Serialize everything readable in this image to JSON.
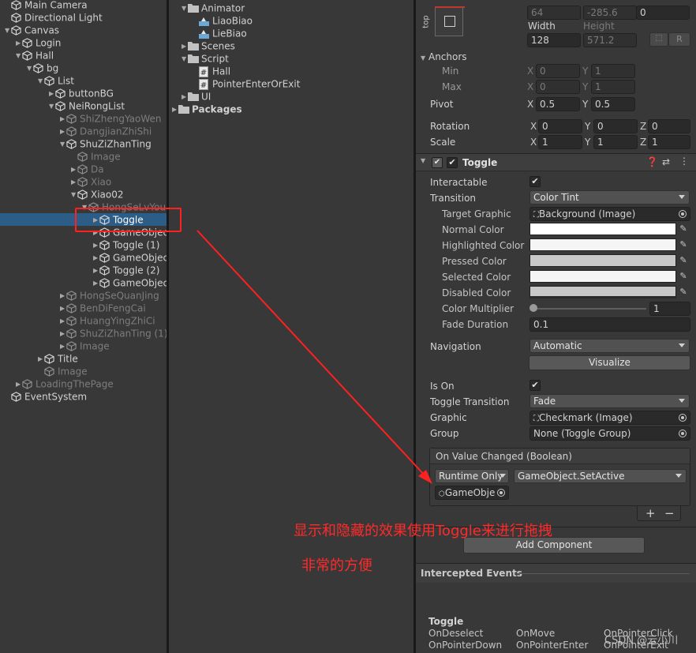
{
  "hierarchy": {
    "items": [
      {
        "label": "Main Camera",
        "indent": 0,
        "expanded": null,
        "dim": false,
        "selected": false
      },
      {
        "label": "Directional Light",
        "indent": 0,
        "expanded": null,
        "dim": false,
        "selected": false
      },
      {
        "label": "Canvas",
        "indent": 0,
        "expanded": true,
        "dim": false,
        "selected": false
      },
      {
        "label": "Login",
        "indent": 1,
        "expanded": false,
        "dim": false,
        "selected": false
      },
      {
        "label": "Hall",
        "indent": 1,
        "expanded": true,
        "dim": false,
        "selected": false
      },
      {
        "label": "bg",
        "indent": 2,
        "expanded": true,
        "dim": false,
        "selected": false
      },
      {
        "label": "List",
        "indent": 3,
        "expanded": true,
        "dim": false,
        "selected": false
      },
      {
        "label": "buttonBG",
        "indent": 4,
        "expanded": false,
        "dim": false,
        "selected": false
      },
      {
        "label": "NeiRongList",
        "indent": 4,
        "expanded": true,
        "dim": false,
        "selected": false
      },
      {
        "label": "ShiZhengYaoWen",
        "indent": 5,
        "expanded": false,
        "dim": true,
        "selected": false
      },
      {
        "label": "DangjianZhiShi",
        "indent": 5,
        "expanded": false,
        "dim": true,
        "selected": false
      },
      {
        "label": "ShuZiZhanTing",
        "indent": 5,
        "expanded": true,
        "dim": false,
        "selected": false
      },
      {
        "label": "Image",
        "indent": 6,
        "expanded": null,
        "dim": true,
        "selected": false
      },
      {
        "label": "Da",
        "indent": 6,
        "expanded": false,
        "dim": true,
        "selected": false
      },
      {
        "label": "Xiao",
        "indent": 6,
        "expanded": false,
        "dim": true,
        "selected": false
      },
      {
        "label": "Xiao02",
        "indent": 6,
        "expanded": true,
        "dim": false,
        "selected": false
      },
      {
        "label": "HongSeLvYou",
        "indent": 7,
        "expanded": true,
        "dim": true,
        "selected": false
      },
      {
        "label": "Toggle",
        "indent": 8,
        "expanded": false,
        "dim": false,
        "selected": true
      },
      {
        "label": "GameObject",
        "indent": 8,
        "expanded": false,
        "dim": false,
        "selected": false
      },
      {
        "label": "Toggle (1)",
        "indent": 8,
        "expanded": false,
        "dim": false,
        "selected": false
      },
      {
        "label": "GameObject (",
        "indent": 8,
        "expanded": false,
        "dim": false,
        "selected": false
      },
      {
        "label": "Toggle (2)",
        "indent": 8,
        "expanded": false,
        "dim": false,
        "selected": false
      },
      {
        "label": "GameObject (",
        "indent": 8,
        "expanded": false,
        "dim": false,
        "selected": false
      },
      {
        "label": "HongSeQuanJing",
        "indent": 5,
        "expanded": false,
        "dim": true,
        "selected": false
      },
      {
        "label": "BenDiFengCai",
        "indent": 5,
        "expanded": false,
        "dim": true,
        "selected": false
      },
      {
        "label": "HuangYingZhiCi",
        "indent": 5,
        "expanded": false,
        "dim": true,
        "selected": false
      },
      {
        "label": "ShuZiZhanTing (1)",
        "indent": 5,
        "expanded": false,
        "dim": true,
        "selected": false
      },
      {
        "label": "Image",
        "indent": 5,
        "expanded": false,
        "dim": true,
        "selected": false
      },
      {
        "label": "Title",
        "indent": 3,
        "expanded": false,
        "dim": false,
        "selected": false
      },
      {
        "label": "Image",
        "indent": 3,
        "expanded": null,
        "dim": true,
        "selected": false
      },
      {
        "label": "LoadingThePage",
        "indent": 1,
        "expanded": false,
        "dim": true,
        "selected": false
      },
      {
        "label": "EventSystem",
        "indent": 0,
        "expanded": null,
        "dim": false,
        "selected": false
      }
    ]
  },
  "project": {
    "items": [
      {
        "label": "Animator",
        "type": "folder",
        "indent": 0,
        "expanded": true
      },
      {
        "label": "LiaoBiao",
        "type": "anim",
        "indent": 1,
        "expanded": null
      },
      {
        "label": "LieBiao",
        "type": "anim",
        "indent": 1,
        "expanded": null
      },
      {
        "label": "Scenes",
        "type": "folder",
        "indent": 0,
        "expanded": false
      },
      {
        "label": "Script",
        "type": "folder",
        "indent": 0,
        "expanded": true
      },
      {
        "label": "Hall",
        "type": "script",
        "indent": 1,
        "expanded": null
      },
      {
        "label": "PointerEnterOrExit",
        "type": "script",
        "indent": 1,
        "expanded": null
      },
      {
        "label": "UI",
        "type": "folder",
        "indent": 0,
        "expanded": false
      },
      {
        "label": "Packages",
        "type": "folder",
        "indent": -1,
        "expanded": false
      }
    ]
  },
  "rect_transform": {
    "pos_x": "64",
    "pos_y": "-285.6",
    "pos_z": "0",
    "width_label": "Width",
    "height_label": "Height",
    "width": "128",
    "height": "571.2",
    "anchor_side_label": "top",
    "anchors_label": "Anchors",
    "min_label": "Min",
    "max_label": "Max",
    "min_x": "0",
    "min_y": "1",
    "max_x": "0",
    "max_y": "1",
    "pivot_label": "Pivot",
    "pivot_x": "0.5",
    "pivot_y": "0.5",
    "rotation_label": "Rotation",
    "rot_x": "0",
    "rot_y": "0",
    "rot_z": "0",
    "scale_label": "Scale",
    "scale_x": "1",
    "scale_y": "1",
    "scale_z": "1",
    "r_button": "R",
    "axis_x": "X",
    "axis_y": "Y",
    "axis_z": "Z"
  },
  "toggle": {
    "title": "Toggle",
    "interactable_label": "Interactable",
    "transition_label": "Transition",
    "transition_value": "Color Tint",
    "target_graphic_label": "Target Graphic",
    "target_graphic_value": "Background (Image)",
    "normal_color_label": "Normal Color",
    "highlighted_color_label": "Highlighted Color",
    "pressed_color_label": "Pressed Color",
    "selected_color_label": "Selected Color",
    "disabled_color_label": "Disabled Color",
    "normal_color": "#ffffff",
    "highlighted_color": "#f5f5f5",
    "pressed_color": "#c8c8c8",
    "selected_color": "#f5f5f5",
    "disabled_color": "#c8c8c8",
    "color_multiplier_label": "Color Multiplier",
    "color_multiplier_value": "1",
    "fade_duration_label": "Fade Duration",
    "fade_duration_value": "0.1",
    "navigation_label": "Navigation",
    "navigation_value": "Automatic",
    "visualize_label": "Visualize",
    "is_on_label": "Is On",
    "toggle_transition_label": "Toggle Transition",
    "toggle_transition_value": "Fade",
    "graphic_label": "Graphic",
    "graphic_value": "Checkmark (Image)",
    "group_label": "Group",
    "group_value": "None (Toggle Group)",
    "event_header": "On Value Changed (Boolean)",
    "runtime_value": "Runtime Only",
    "function_value": "GameObject.SetActive",
    "target_object": "GameObje",
    "plus": "+",
    "minus": "−"
  },
  "add_component_label": "Add Component",
  "intercepted_events": {
    "header": "Intercepted Events",
    "component": "Toggle",
    "events": [
      "OnDeselect",
      "OnMove",
      "OnPointerClick",
      "OnPointerDown",
      "OnPointerEnter",
      "OnPointerExit"
    ]
  },
  "annotation": {
    "line1": "显示和隐藏的效果使用Toggle来进行拖拽",
    "line2": "非常的方便",
    "color": "#ff2a2a"
  },
  "watermark": "CSDN @云小川"
}
